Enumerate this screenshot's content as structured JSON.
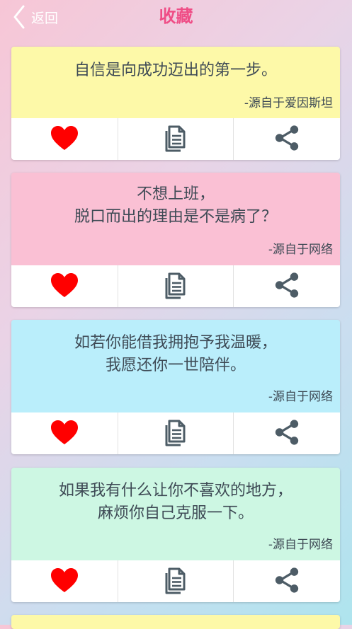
{
  "header": {
    "back_label": "返回",
    "title": "收藏"
  },
  "colors": {
    "title": "#ef4d86",
    "heart": "#ff0000",
    "icon_gray": "#4d5c66",
    "card_yellow": "#fdf9a8",
    "card_pink": "#fac0d4",
    "card_blue": "#baeefb",
    "card_green": "#cdf7e3"
  },
  "icons": {
    "back": "chevron-left-icon",
    "like": "heart-icon",
    "copy": "copy-document-icon",
    "share": "share-icon"
  },
  "cards": [
    {
      "lines": [
        "自信是向成功迈出的第一步。"
      ],
      "source": "-源自于爱因斯坦"
    },
    {
      "lines": [
        "不想上班，",
        "脱口而出的理由是不是病了？"
      ],
      "source": "-源自于网络"
    },
    {
      "lines": [
        "如若你能借我拥抱予我温暖，",
        "我愿还你一世陪伴。"
      ],
      "source": "-源自于网络"
    },
    {
      "lines": [
        "如果我有什么让你不喜欢的地方，",
        "麻烦你自己克服一下。"
      ],
      "source": "-源自于网络"
    }
  ]
}
